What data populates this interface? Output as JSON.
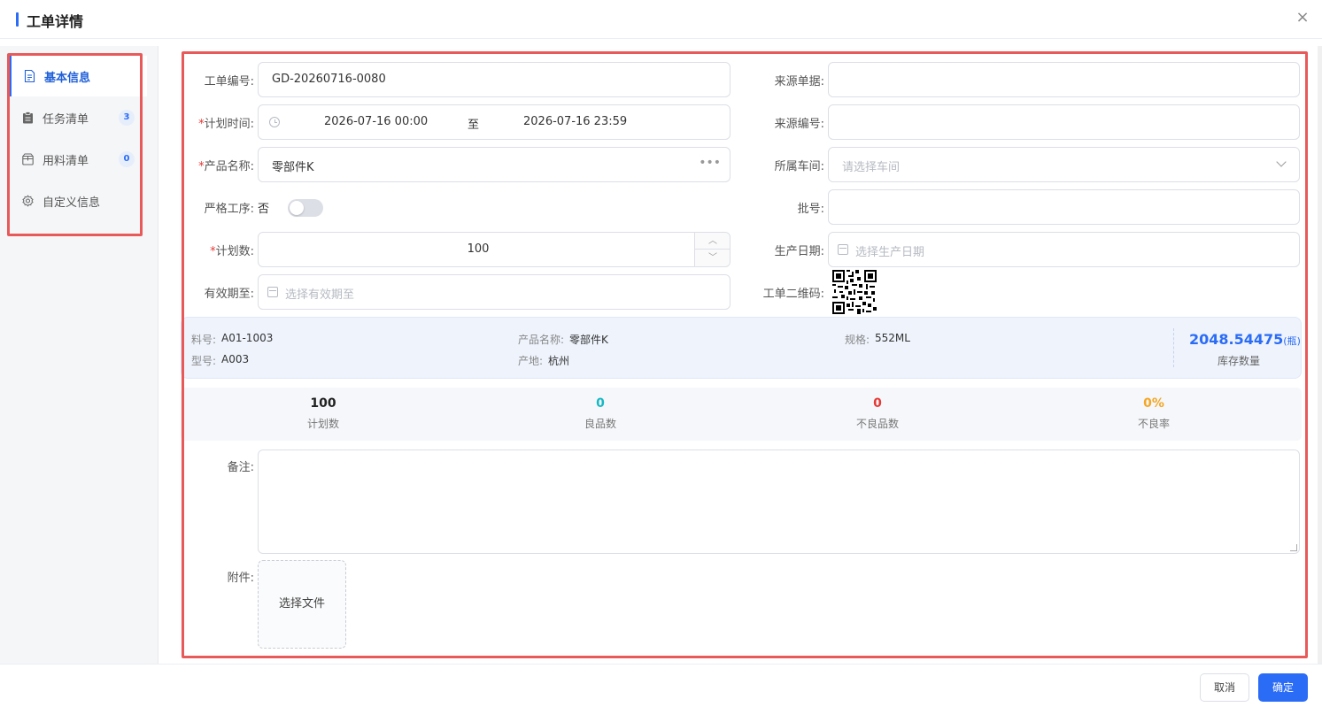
{
  "header": {
    "title": "工单详情",
    "close_icon": "×"
  },
  "sidebar": {
    "items": [
      {
        "label": "基本信息",
        "icon": "document-icon",
        "active": true
      },
      {
        "label": "任务清单",
        "icon": "clipboard-icon",
        "badge": "3"
      },
      {
        "label": "用料清单",
        "icon": "package-icon",
        "badge": "0"
      },
      {
        "label": "自定义信息",
        "icon": "gear-icon"
      }
    ]
  },
  "form": {
    "order_no": {
      "label": "工单编号:",
      "value": "GD-20260716-0080"
    },
    "source_doc": {
      "label": "来源单据:",
      "value": ""
    },
    "plan_time": {
      "label": "计划时间:",
      "start": "2026-07-16 00:00",
      "sep": "至",
      "end": "2026-07-16 23:59"
    },
    "source_no": {
      "label": "来源编号:",
      "value": ""
    },
    "product_name": {
      "label": "产品名称:",
      "value": "零部件K",
      "more": "•••"
    },
    "workshop": {
      "label": "所属车间:",
      "placeholder": "请选择车间"
    },
    "strict_process": {
      "label": "严格工序:",
      "value": "否"
    },
    "batch_no": {
      "label": "批号:",
      "value": ""
    },
    "plan_qty": {
      "label": "计划数:",
      "value": "100",
      "up": "︿",
      "down": "﹀"
    },
    "prod_date": {
      "label": "生产日期:",
      "placeholder": "选择生产日期"
    },
    "expiry": {
      "label": "有效期至:",
      "placeholder": "选择有效期至"
    },
    "qrcode": {
      "label": "工单二维码:"
    },
    "remark": {
      "label": "备注:"
    },
    "attachment": {
      "label": "附件:",
      "button": "选择文件"
    }
  },
  "info": {
    "material_no_k": "料号:",
    "material_no_v": "A01-1003",
    "model_k": "型号:",
    "model_v": "A003",
    "product_k": "产品名称:",
    "product_v": "零部件K",
    "origin_k": "产地:",
    "origin_v": "杭州",
    "spec_k": "规格:",
    "spec_v": "552ML",
    "stock_value": "2048.54475",
    "stock_unit": "(瓶)",
    "stock_label": "库存数量"
  },
  "stats": [
    {
      "value": "100",
      "label": "计划数",
      "color": "#222222"
    },
    {
      "value": "0",
      "label": "良品数",
      "color": "#16b8c4"
    },
    {
      "value": "0",
      "label": "不良品数",
      "color": "#e53935"
    },
    {
      "value": "0%",
      "label": "不良率",
      "color": "#f5a623"
    }
  ],
  "footer": {
    "cancel": "取消",
    "ok": "确定"
  },
  "colors": {
    "accent": "#2b6cf6",
    "highlight": "#e85a5a"
  }
}
